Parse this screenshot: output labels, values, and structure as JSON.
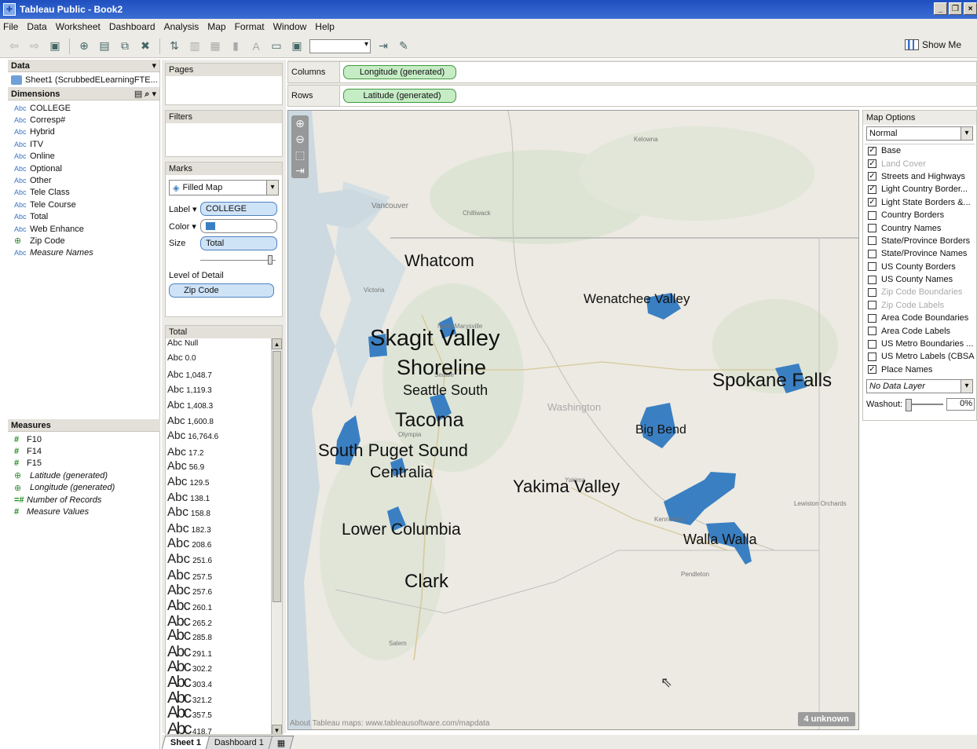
{
  "window": {
    "title": "Tableau Public - Book2",
    "controls": [
      "_",
      "❐",
      "×"
    ]
  },
  "menu": [
    "File",
    "Data",
    "Worksheet",
    "Dashboard",
    "Analysis",
    "Map",
    "Format",
    "Window",
    "Help"
  ],
  "toolbar": {
    "show_me": "Show Me"
  },
  "data_pane": {
    "header": "Data",
    "datasource": "Sheet1 (ScrubbedELearningFTE...",
    "dimensions_header": "Dimensions",
    "dimensions": [
      {
        "type": "Abc",
        "name": "COLLEGE"
      },
      {
        "type": "Abc",
        "name": "Corresp#"
      },
      {
        "type": "Abc",
        "name": "Hybrid"
      },
      {
        "type": "Abc",
        "name": "ITV"
      },
      {
        "type": "Abc",
        "name": "Online"
      },
      {
        "type": "Abc",
        "name": "Optional"
      },
      {
        "type": "Abc",
        "name": "Other"
      },
      {
        "type": "Abc",
        "name": "Tele Class"
      },
      {
        "type": "Abc",
        "name": "Tele Course"
      },
      {
        "type": "Abc",
        "name": "Total"
      },
      {
        "type": "Abc",
        "name": "Web Enhance"
      },
      {
        "type": "geo",
        "name": "Zip Code"
      },
      {
        "type": "Abc",
        "name": "Measure Names"
      }
    ],
    "measures_header": "Measures",
    "measures": [
      {
        "type": "#",
        "name": "F10"
      },
      {
        "type": "#",
        "name": "F14"
      },
      {
        "type": "#",
        "name": "F15"
      },
      {
        "type": "geo",
        "name": "Latitude (generated)"
      },
      {
        "type": "geo",
        "name": "Longitude (generated)"
      },
      {
        "type": "=#",
        "name": "Number of Records"
      },
      {
        "type": "#",
        "name": "Measure Values"
      }
    ]
  },
  "shelves": {
    "pages": "Pages",
    "filters": "Filters",
    "columns_label": "Columns",
    "columns_pill": "Longitude (generated)",
    "rows_label": "Rows",
    "rows_pill": "Latitude (generated)"
  },
  "marks": {
    "title": "Marks",
    "type": "Filled Map",
    "label_lbl": "Label",
    "label_pill": "COLLEGE",
    "color_lbl": "Color",
    "size_lbl": "Size",
    "size_pill": "Total",
    "detail_title": "Level of Detail",
    "detail_pill": "Zip Code"
  },
  "total_legend": {
    "title": "Total",
    "abc": "Abc",
    "items": [
      "Null",
      "0.0",
      "1,048.7",
      "1,119.3",
      "1,408.3",
      "1,600.8",
      "16,764.6",
      "17.2",
      "56.9",
      "129.5",
      "138.1",
      "158.8",
      "182.3",
      "208.6",
      "251.6",
      "257.5",
      "257.6",
      "260.1",
      "265.2",
      "285.8",
      "291.1",
      "302.2",
      "303.4",
      "321.2",
      "357.5",
      "418.7"
    ]
  },
  "map": {
    "attribution": "About Tableau maps: www.tableausoftware.com/mapdata",
    "unknown_badge": "4 unknown",
    "college_labels": [
      "Whatcom",
      "Wenatchee Valley",
      "Skagit Valley",
      "Shoreline",
      "Seattle South",
      "Spokane Falls",
      "Tacoma",
      "Big Bend",
      "South Puget Sound",
      "Centralia",
      "Yakima Valley",
      "Lower Columbia",
      "Walla Walla",
      "Clark"
    ],
    "places": [
      "Kelowna",
      "Vancouver",
      "Chilliwack",
      "Victoria",
      "North Marysville",
      "Olympia",
      "Washington",
      "Yakima",
      "Kennewick",
      "Lewiston Orchards",
      "Pendleton",
      "Salem",
      "Seattle"
    ],
    "fill_color": "#3a7fc2"
  },
  "map_options": {
    "title": "Map Options",
    "style": "Normal",
    "layers": [
      {
        "name": "Base",
        "checked": true,
        "enabled": true
      },
      {
        "name": "Land Cover",
        "checked": true,
        "enabled": false
      },
      {
        "name": "Streets and Highways",
        "checked": true,
        "enabled": true
      },
      {
        "name": "Light Country Border...",
        "checked": true,
        "enabled": true
      },
      {
        "name": "Light State Borders &...",
        "checked": true,
        "enabled": true
      },
      {
        "name": "Country Borders",
        "checked": false,
        "enabled": true
      },
      {
        "name": "Country Names",
        "checked": false,
        "enabled": true
      },
      {
        "name": "State/Province Borders",
        "checked": false,
        "enabled": true
      },
      {
        "name": "State/Province Names",
        "checked": false,
        "enabled": true
      },
      {
        "name": "US County Borders",
        "checked": false,
        "enabled": true
      },
      {
        "name": "US County Names",
        "checked": false,
        "enabled": true
      },
      {
        "name": "Zip Code Boundaries",
        "checked": false,
        "enabled": false
      },
      {
        "name": "Zip Code Labels",
        "checked": false,
        "enabled": false
      },
      {
        "name": "Area Code Boundaries",
        "checked": false,
        "enabled": true
      },
      {
        "name": "Area Code Labels",
        "checked": false,
        "enabled": true
      },
      {
        "name": "US Metro Boundaries ...",
        "checked": false,
        "enabled": true
      },
      {
        "name": "US Metro Labels (CBSA)",
        "checked": false,
        "enabled": true
      },
      {
        "name": "Place Names",
        "checked": true,
        "enabled": true
      }
    ],
    "data_layer": "No Data Layer",
    "washout_label": "Washout:",
    "washout_value": "0%"
  },
  "tabs": [
    {
      "name": "Sheet 1",
      "active": true
    },
    {
      "name": "Dashboard 1",
      "active": false
    }
  ]
}
